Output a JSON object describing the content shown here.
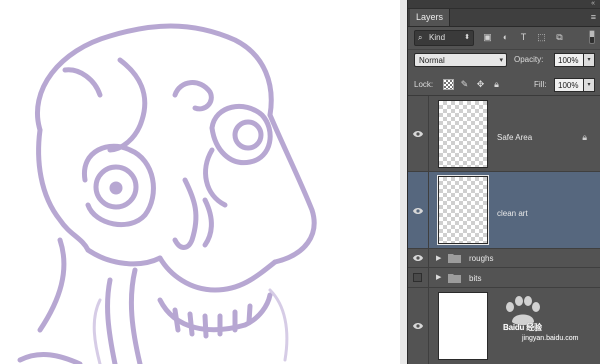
{
  "panel": {
    "tab_label": "Layers",
    "tab_close": "×",
    "collapse": "«",
    "menu_icon": "≡"
  },
  "filter": {
    "kind_label": "Kind",
    "icons": [
      "image-filter-icon",
      "adjustment-filter-icon",
      "type-filter-icon",
      "shape-filter-icon",
      "smart-object-filter-icon"
    ]
  },
  "blend": {
    "mode": "Normal",
    "opacity_label": "Opacity:",
    "opacity_value": "100%"
  },
  "lock": {
    "label": "Lock:",
    "fill_label": "Fill:",
    "fill_value": "100%"
  },
  "layers": [
    {
      "name": "Safe Area",
      "visible": true,
      "locked": true,
      "selected": false,
      "type": "layer"
    },
    {
      "name": "clean art",
      "visible": true,
      "locked": false,
      "selected": true,
      "type": "layer"
    },
    {
      "name": "roughs",
      "visible": true,
      "type": "group"
    },
    {
      "name": "bits",
      "visible": false,
      "type": "group"
    },
    {
      "name": "",
      "visible": true,
      "type": "background"
    }
  ],
  "watermark": {
    "text": "Baidu 经验",
    "sub": "jingyan.baidu.com"
  },
  "colors": {
    "panel_bg": "#535353",
    "selected_row": "#56677e",
    "sketch_stroke": "#b7a7d2"
  }
}
